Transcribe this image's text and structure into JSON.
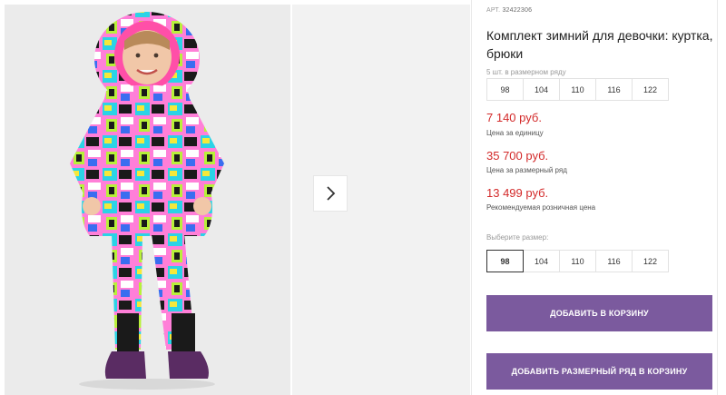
{
  "product": {
    "article_label": "АРТ.",
    "article_number": "32422306",
    "title": "Комплект зимний для девочки: куртка, брюки"
  },
  "size_row": {
    "count_text": "5 шт. в размерном ряду",
    "sizes": [
      "98",
      "104",
      "110",
      "116",
      "122"
    ]
  },
  "prices": {
    "unit_price": "7 140 руб.",
    "unit_price_note": "Цена за единицу",
    "row_price": "35 700 руб.",
    "row_price_note": "Цена за размерный ряд",
    "retail_price": "13 499 руб.",
    "retail_price_note": "Рекомендуемая розничная цена"
  },
  "size_select": {
    "label": "Выберите размер:",
    "options": [
      "98",
      "104",
      "110",
      "116",
      "122"
    ],
    "selected": "98"
  },
  "buttons": {
    "add_to_cart": "ДОБАВИТЬ В КОРЗИНУ",
    "add_row_to_cart": "ДОБАВИТЬ РАЗМЕРНЫЙ РЯД В КОРЗИНУ"
  },
  "colors": {
    "price": "#d32a2a",
    "button": "#7b5a9e"
  },
  "icons": {
    "next": "chevron-right-icon"
  }
}
